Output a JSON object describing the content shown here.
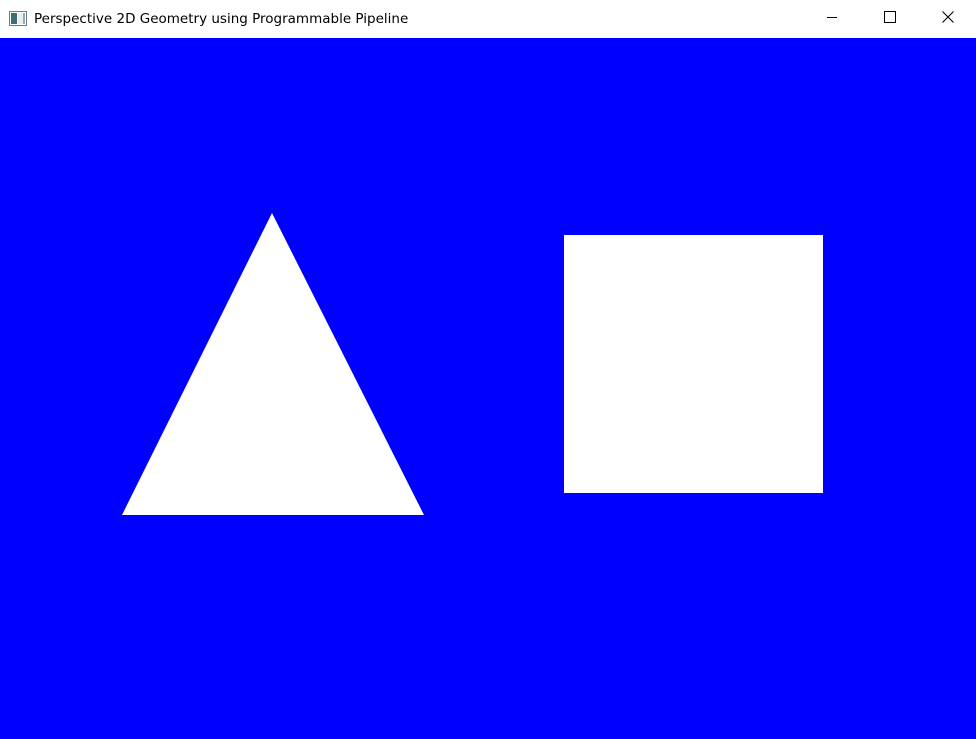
{
  "window": {
    "title": "Perspective 2D Geometry using Programmable Pipeline",
    "app_icon": "app-window-icon",
    "controls": {
      "minimize_icon": "minimize-icon",
      "maximize_icon": "maximize-icon",
      "close_icon": "close-icon"
    }
  },
  "scene": {
    "clear_color": "#0000FF",
    "shape_color": "#FFFFFF",
    "shapes": [
      {
        "kind": "triangle"
      },
      {
        "kind": "square"
      }
    ]
  }
}
